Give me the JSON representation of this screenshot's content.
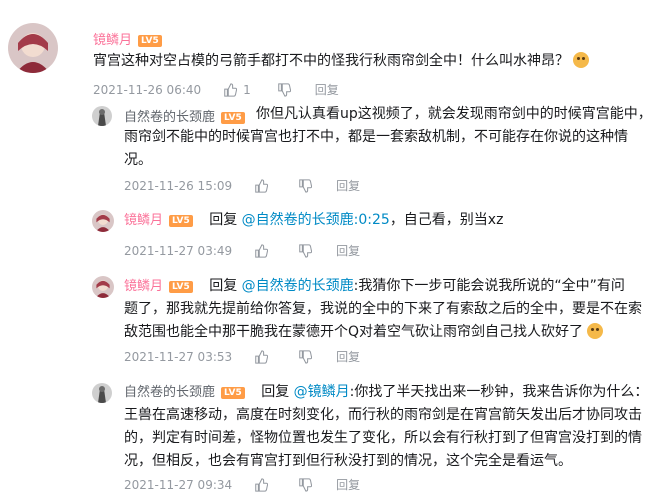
{
  "main_comment": {
    "username": "镜鳞月",
    "level": "LV5",
    "text": "宵宫这种对空占模的弓箭手都打不中的怪我行秋雨帘剑全中！什么叫水神昂？",
    "time": "2021-11-26 06:40",
    "likes": "1",
    "reply_label": "回复"
  },
  "replies": [
    {
      "username": "自然卷的长颈鹿",
      "level": "LV5",
      "line1": "你但凡认真看up这视频了，就会发现雨帘剑中的时候宵宫能中，",
      "line2": "雨帘剑不能中的时候宵宫也打不中，都是一套索敌机制，不可能存在你说的这种情",
      "line3": "况。",
      "time": "2021-11-26 15:09",
      "reply_label": "回复"
    },
    {
      "username": "镜鳞月",
      "level": "LV5",
      "prefix": "回复",
      "mention": "@自然卷的长颈鹿",
      "timestamp_link": ":0:25",
      "text": "，自己看，别当xz",
      "time": "2021-11-27 03:49",
      "reply_label": "回复"
    },
    {
      "username": "镜鳞月",
      "level": "LV5",
      "prefix": "回复",
      "mention": "@自然卷的长颈鹿",
      "line1": ":我猜你下一步可能会说我所说的“全中”有问",
      "line2": "题了，那我就先提前给你答复，我说的全中的下来了有索敌之后的全中，要是不在索",
      "line3": "敌范围也能全中那干脆我在蒙德开个Q对着空气砍让雨帘剑自己找人砍好了",
      "time": "2021-11-27 03:53",
      "reply_label": "回复"
    },
    {
      "username": "自然卷的长颈鹿",
      "level": "LV5",
      "prefix": "回复",
      "mention": "@镜鳞月",
      "line1": ":你找了半天找出来一秒钟，我来告诉你为什么：",
      "line2": "王兽在高速移动，高度在时刻变化，而行秋的雨帘剑是在宵宫箭矢发出后才协同攻击",
      "line3": "的，判定有时间差，怪物位置也发生了变化，所以会有行秋打到了但宵宫没打到的情",
      "line4": "况，但相反，也会有宵宫打到但行秋没打到的情况，这个完全是看运气。",
      "time": "2021-11-27 09:34",
      "reply_label": "回复"
    }
  ],
  "icons": {
    "like": "thumbs-up-icon",
    "dislike": "thumbs-down-icon",
    "emoji": "doge-emoji-icon"
  },
  "colors": {
    "username": "#fb7299",
    "mention": "#008ac5",
    "meta": "#9499a0",
    "level_badge": "#ff9c46"
  }
}
